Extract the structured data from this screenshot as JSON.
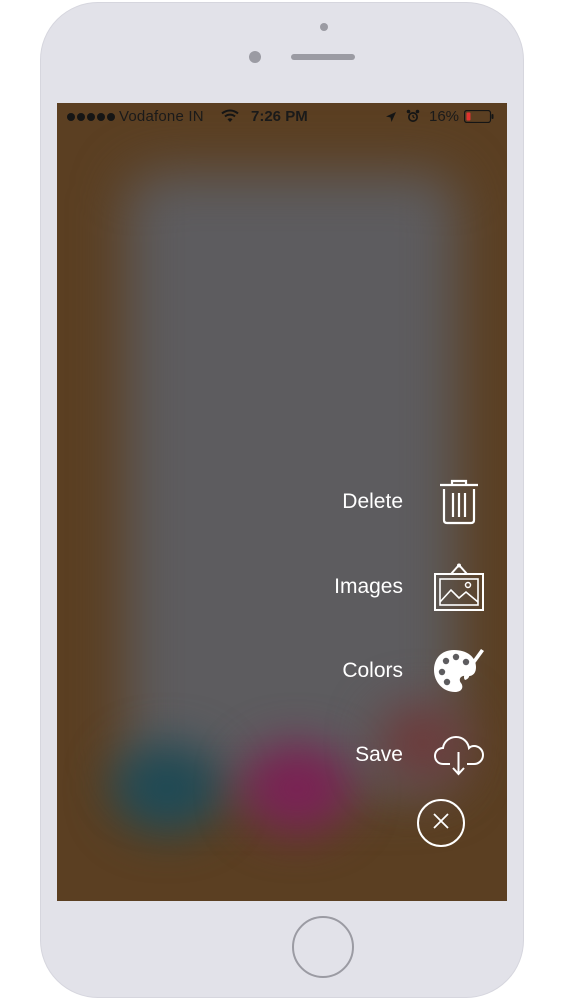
{
  "status_bar": {
    "carrier": "Vodafone IN",
    "time": "7:26 PM",
    "battery": "16%"
  },
  "menu": {
    "items": [
      {
        "label": "Delete",
        "icon": "trash-icon"
      },
      {
        "label": "Images",
        "icon": "image-frame-icon"
      },
      {
        "label": "Colors",
        "icon": "palette-icon"
      },
      {
        "label": "Save",
        "icon": "cloud-download-icon"
      }
    ],
    "close_icon": "close-icon"
  },
  "colors": {
    "background_brown": "#5b3f22",
    "blur_gray": "#5d5c5f",
    "menu_text": "#ffffff",
    "battery_low": "#e0332f"
  }
}
